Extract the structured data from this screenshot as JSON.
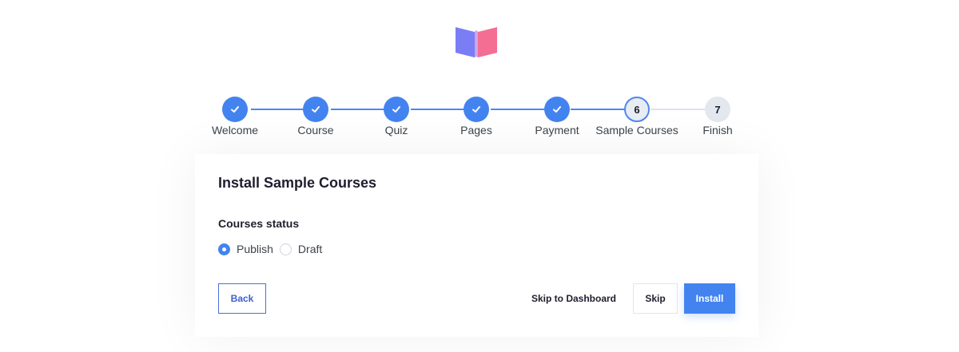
{
  "steps": [
    {
      "label": "Welcome",
      "state": "done",
      "number": "1"
    },
    {
      "label": "Course",
      "state": "done",
      "number": "2"
    },
    {
      "label": "Quiz",
      "state": "done",
      "number": "3"
    },
    {
      "label": "Pages",
      "state": "done",
      "number": "4"
    },
    {
      "label": "Payment",
      "state": "done",
      "number": "5"
    },
    {
      "label": "Sample Courses",
      "state": "current",
      "number": "6"
    },
    {
      "label": "Finish",
      "state": "pending",
      "number": "7"
    }
  ],
  "card": {
    "title": "Install Sample Courses",
    "status_label": "Courses status",
    "options": [
      {
        "label": "Publish",
        "checked": true
      },
      {
        "label": "Draft",
        "checked": false
      }
    ]
  },
  "buttons": {
    "back": "Back",
    "skip_to_dashboard": "Skip to Dashboard",
    "skip": "Skip",
    "install": "Install"
  },
  "colors": {
    "accent": "#4383f0",
    "logo_left": "#7a7ef5",
    "logo_right": "#f46d93"
  }
}
